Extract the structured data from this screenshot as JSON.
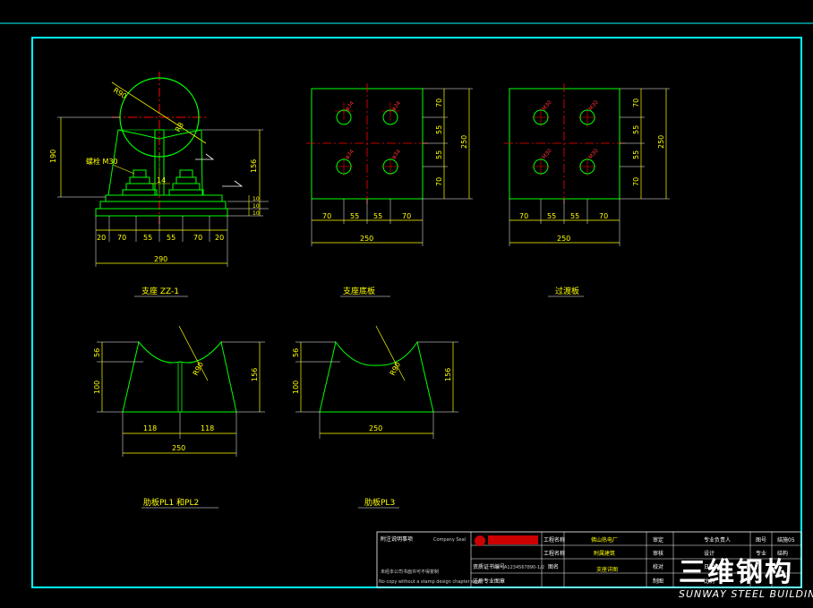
{
  "drawing": {
    "colors": {
      "background": "#000000",
      "frame": "#00ffff",
      "outline": "#00ff00",
      "centerline": "#ff0000",
      "dimension": "#ffff00",
      "extension": "#ffffff"
    },
    "view1": {
      "title": "支座 ZZ-1",
      "radius": "R90",
      "radius_inner": "R8",
      "bolt_label": "螺栓 M30",
      "dim_height_left": "190",
      "dim_height_right": "156",
      "dim_small": [
        "10",
        "10",
        "10"
      ],
      "dim_bottom_parts": [
        "20",
        "70",
        "55",
        "55",
        "70",
        "20"
      ],
      "dim_bottom_total": "290",
      "dim_web": "14"
    },
    "view2": {
      "title": "支座底板",
      "hole_labels": [
        "φ34",
        "φ34",
        "φ34",
        "φ34"
      ],
      "dim_top_parts": [
        "70",
        "55",
        "55",
        "70"
      ],
      "dim_top_total": "250",
      "dim_side_parts": [
        "70",
        "55",
        "55",
        "70"
      ],
      "dim_side_total": "250"
    },
    "view3": {
      "title": "过渡板",
      "hole_labels": [
        "M30",
        "M30",
        "M30",
        "M30"
      ],
      "dim_top_parts": [
        "70",
        "55",
        "55",
        "70"
      ],
      "dim_top_total": "250",
      "dim_side_parts": [
        "70",
        "55",
        "55",
        "70"
      ],
      "dim_side_total": "250"
    },
    "view4": {
      "title": "肋板PL1 和PL2",
      "dim_top": "56",
      "dim_left": "100",
      "dim_right": "156",
      "radius": "R90",
      "dim_bottom_parts": [
        "118",
        "118"
      ],
      "dim_bottom_total": "250"
    },
    "view5": {
      "title": "肋板PL3",
      "dim_top": "56",
      "dim_left": "100",
      "dim_right": "156",
      "radius": "R90",
      "dim_bottom_total": "250"
    },
    "title_block": {
      "label_notes": "附注说明事项",
      "label_company_seal": "Company Seal",
      "note_cn": "未经本公司书面许可不得复制",
      "note_en": "No copy without a stamp design chapter seal",
      "r1": [
        "工程名称",
        "佛山热电厂",
        "审定",
        "专业负责人",
        "图号",
        "结施05"
      ],
      "r2": [
        "工程名称",
        "附属建筑",
        "审核",
        "设计",
        "专业",
        "结构"
      ],
      "r3": [
        "资质证书编号",
        "A1234567890-1/2",
        "图名",
        "支座详图",
        "校对",
        "日期"
      ],
      "r4": [
        "注册专业图章",
        "",
        "",
        "",
        "制图",
        "比例"
      ]
    },
    "watermark": {
      "cn": "三维钢构",
      "en": "SUNWAY STEEL BUILDING"
    }
  }
}
